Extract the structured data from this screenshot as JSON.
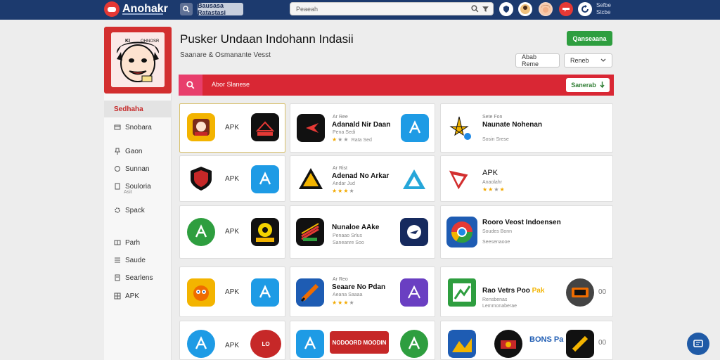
{
  "topbar": {
    "logo_text": "Anohakr",
    "pill_label": "Bausasa Ratastasi",
    "search_placeholder": "Peaeah",
    "status_line1": "Sefbe",
    "status_line2": "Stcbe"
  },
  "colors": {
    "topbar": "#1c3a6e",
    "accent_red": "#d92734",
    "accent_green": "#2e9e3f",
    "link_blue": "#1f5aa6"
  },
  "sidebar": {
    "items": [
      {
        "label": "Sedhaha",
        "icon": "none"
      },
      {
        "label": "Snobara",
        "icon": "card-icon"
      },
      {
        "label": "Gaon",
        "icon": "pin-icon"
      },
      {
        "label": "Sunnan",
        "icon": "circle-icon"
      },
      {
        "label": "Souloria",
        "sub": "Asit",
        "icon": "doc-icon"
      },
      {
        "label": "Spack",
        "icon": "gear-icon"
      },
      {
        "label": "Parh",
        "icon": "book-icon"
      },
      {
        "label": "Saude",
        "icon": "list-icon"
      },
      {
        "label": "Searlens",
        "icon": "doc-icon"
      },
      {
        "label": "APK",
        "icon": "grid-icon"
      }
    ]
  },
  "header": {
    "title": "Pusker Undaan Indohann Indasii",
    "subtitle": "Saanare & Osmanante Vesst",
    "green_button": "Qanseaana",
    "outline_button": "Abab Reme",
    "dropdown_label": "Reneb"
  },
  "redbar": {
    "text": "Abor Slanese",
    "button": "Sanerab"
  },
  "cards": [
    {
      "apk": "APK"
    },
    {
      "small": "Ar Ree",
      "title": "Adanald Nir Daan",
      "meta": "Pena Sedi",
      "rating_line": "Rata Sed"
    },
    {
      "small": "Sete Fon",
      "title": "Naunate Nohenan",
      "meta": "Sosin Srese"
    },
    {
      "apk": "APK"
    },
    {
      "small": "Ar Rist",
      "title": "Adenad No Arkar",
      "meta": "Andar Jud"
    },
    {
      "apk_title": "APK",
      "meta": "Anaolahr"
    },
    {
      "apk": "APK"
    },
    {
      "title": "Nunaloe AAke",
      "meta": "Penaao Srlus",
      "meta2": "Saneanre Soo"
    },
    {
      "title": "Rooro Veost Indoensen",
      "meta": "Soudes Bonn",
      "meta2": "Seesenaooe"
    },
    {
      "apk": "APK"
    },
    {
      "small": "Ar Reo",
      "title": "Seaare No Pdan",
      "meta": "Aeana Saaaa"
    },
    {
      "title": "Rao Vetrs Poo",
      "apk_suffix": "Pak",
      "meta": "Rensbenas",
      "meta2": "Lemmonaberae",
      "side": "00"
    },
    {
      "badge": "LO",
      "apk": "APK"
    },
    {
      "badge": "NODOORD MOODIN"
    },
    {
      "badge": "BONS Pa",
      "side": "00"
    }
  ]
}
